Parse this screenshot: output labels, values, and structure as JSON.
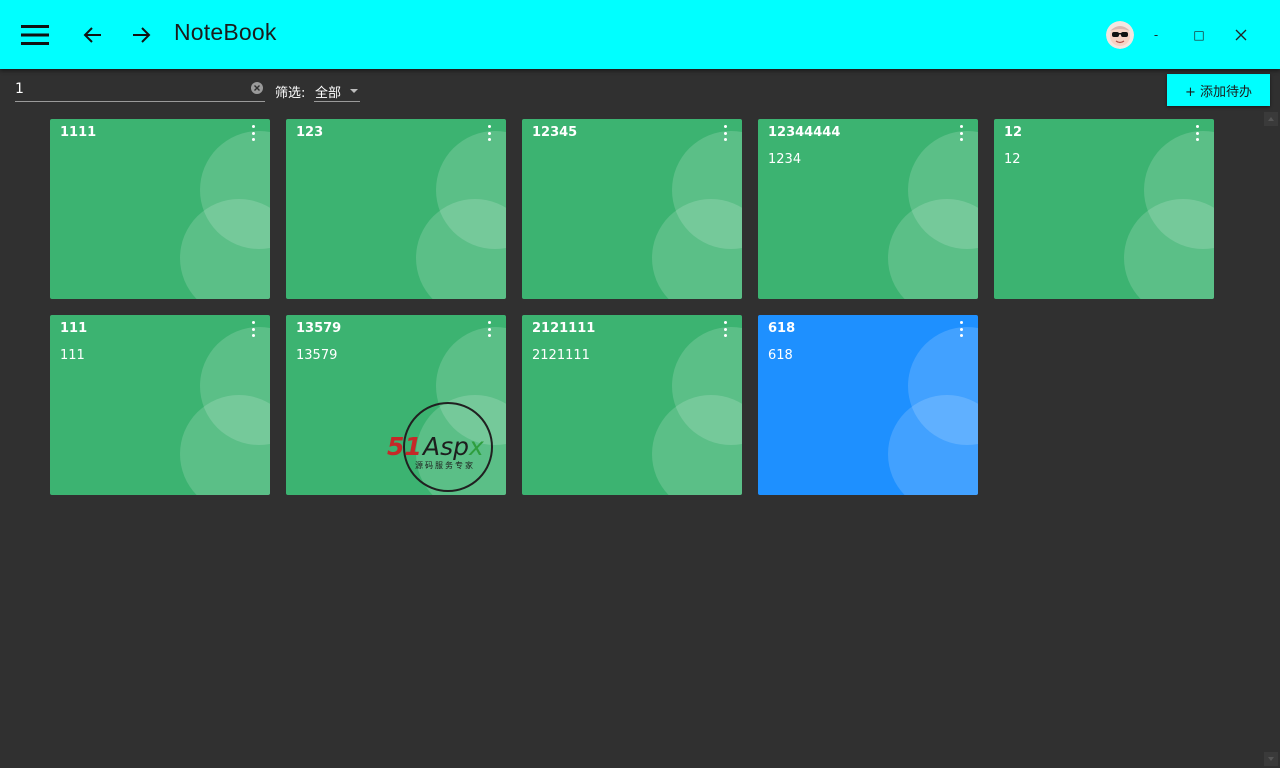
{
  "window": {
    "title": "NoteBook",
    "minimize_label": "-",
    "maximize_label": "□",
    "close_label": "✕"
  },
  "toolbar": {
    "search_value": "1",
    "filter_label": "筛选:",
    "filter_value": "全部",
    "add_button_label": "+ 添加待办"
  },
  "cards": [
    {
      "title": "1111",
      "content": "",
      "color": "green"
    },
    {
      "title": "123",
      "content": "",
      "color": "green"
    },
    {
      "title": "12345",
      "content": "",
      "color": "green"
    },
    {
      "title": "12344444",
      "content": "1234",
      "color": "green"
    },
    {
      "title": "12",
      "content": "12",
      "color": "green"
    },
    {
      "title": "111",
      "content": "111",
      "color": "green"
    },
    {
      "title": "13579",
      "content": "13579",
      "color": "green"
    },
    {
      "title": "2121111",
      "content": "2121111",
      "color": "green"
    },
    {
      "title": "618",
      "content": "618",
      "color": "blue"
    }
  ],
  "watermark": {
    "brand_red": "51",
    "brand_dark": "Asp",
    "brand_green": "x",
    "tagline": "源码服务专家"
  },
  "colors": {
    "accent": "#00FFFF",
    "background": "#303030",
    "card_green": "#3CB371",
    "card_blue": "#1E90FF"
  }
}
